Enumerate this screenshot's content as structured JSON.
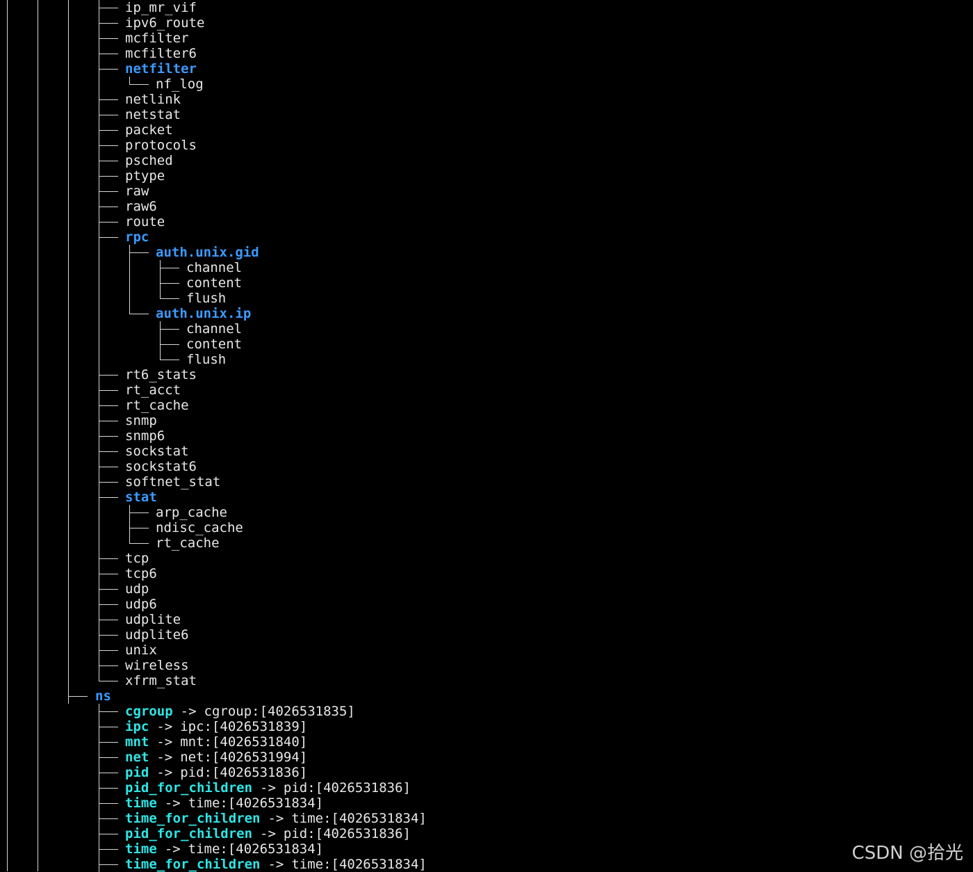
{
  "colors": {
    "background": "#000000",
    "text": "#e8e8e8",
    "directory": "#3a9bff",
    "symlink": "#2ee6e6",
    "tree_lines": "#d8d8d8",
    "watermark": "#d0d0d0"
  },
  "tree": [
    {
      "depth": 1,
      "name": "ip_mr_vif",
      "kind": "file"
    },
    {
      "depth": 1,
      "name": "ipv6_route",
      "kind": "file"
    },
    {
      "depth": 1,
      "name": "mcfilter",
      "kind": "file"
    },
    {
      "depth": 1,
      "name": "mcfilter6",
      "kind": "file"
    },
    {
      "depth": 1,
      "name": "netfilter",
      "kind": "dir"
    },
    {
      "depth": 2,
      "name": "nf_log",
      "kind": "file",
      "last": true
    },
    {
      "depth": 1,
      "name": "netlink",
      "kind": "file"
    },
    {
      "depth": 1,
      "name": "netstat",
      "kind": "file"
    },
    {
      "depth": 1,
      "name": "packet",
      "kind": "file"
    },
    {
      "depth": 1,
      "name": "protocols",
      "kind": "file"
    },
    {
      "depth": 1,
      "name": "psched",
      "kind": "file"
    },
    {
      "depth": 1,
      "name": "ptype",
      "kind": "file"
    },
    {
      "depth": 1,
      "name": "raw",
      "kind": "file"
    },
    {
      "depth": 1,
      "name": "raw6",
      "kind": "file"
    },
    {
      "depth": 1,
      "name": "route",
      "kind": "file"
    },
    {
      "depth": 1,
      "name": "rpc",
      "kind": "dir"
    },
    {
      "depth": 2,
      "name": "auth.unix.gid",
      "kind": "dir"
    },
    {
      "depth": 3,
      "name": "channel",
      "kind": "file"
    },
    {
      "depth": 3,
      "name": "content",
      "kind": "file"
    },
    {
      "depth": 3,
      "name": "flush",
      "kind": "file",
      "last": true
    },
    {
      "depth": 2,
      "name": "auth.unix.ip",
      "kind": "dir",
      "last": true
    },
    {
      "depth": 3,
      "name": "channel",
      "kind": "file"
    },
    {
      "depth": 3,
      "name": "content",
      "kind": "file"
    },
    {
      "depth": 3,
      "name": "flush",
      "kind": "file",
      "last": true
    },
    {
      "depth": 1,
      "name": "rt6_stats",
      "kind": "file"
    },
    {
      "depth": 1,
      "name": "rt_acct",
      "kind": "file"
    },
    {
      "depth": 1,
      "name": "rt_cache",
      "kind": "file"
    },
    {
      "depth": 1,
      "name": "snmp",
      "kind": "file"
    },
    {
      "depth": 1,
      "name": "snmp6",
      "kind": "file"
    },
    {
      "depth": 1,
      "name": "sockstat",
      "kind": "file"
    },
    {
      "depth": 1,
      "name": "sockstat6",
      "kind": "file"
    },
    {
      "depth": 1,
      "name": "softnet_stat",
      "kind": "file"
    },
    {
      "depth": 1,
      "name": "stat",
      "kind": "dir"
    },
    {
      "depth": 2,
      "name": "arp_cache",
      "kind": "file"
    },
    {
      "depth": 2,
      "name": "ndisc_cache",
      "kind": "file"
    },
    {
      "depth": 2,
      "name": "rt_cache",
      "kind": "file",
      "last": true
    },
    {
      "depth": 1,
      "name": "tcp",
      "kind": "file"
    },
    {
      "depth": 1,
      "name": "tcp6",
      "kind": "file"
    },
    {
      "depth": 1,
      "name": "udp",
      "kind": "file"
    },
    {
      "depth": 1,
      "name": "udp6",
      "kind": "file"
    },
    {
      "depth": 1,
      "name": "udplite",
      "kind": "file"
    },
    {
      "depth": 1,
      "name": "udplite6",
      "kind": "file"
    },
    {
      "depth": 1,
      "name": "unix",
      "kind": "file"
    },
    {
      "depth": 1,
      "name": "wireless",
      "kind": "file"
    },
    {
      "depth": 1,
      "name": "xfrm_stat",
      "kind": "file",
      "last": true
    },
    {
      "depth": 0,
      "name": "ns",
      "kind": "dir"
    },
    {
      "depth": 1,
      "name": "cgroup",
      "kind": "link",
      "arrow": "->",
      "target": "cgroup:[4026531835]"
    },
    {
      "depth": 1,
      "name": "ipc",
      "kind": "link",
      "arrow": "->",
      "target": "ipc:[4026531839]"
    },
    {
      "depth": 1,
      "name": "mnt",
      "kind": "link",
      "arrow": "->",
      "target": "mnt:[4026531840]"
    },
    {
      "depth": 1,
      "name": "net",
      "kind": "link",
      "arrow": "->",
      "target": "net:[4026531994]"
    },
    {
      "depth": 1,
      "name": "pid",
      "kind": "link",
      "arrow": "->",
      "target": "pid:[4026531836]"
    },
    {
      "depth": 1,
      "name": "pid_for_children",
      "kind": "link",
      "arrow": "->",
      "target": "pid:[4026531836]"
    },
    {
      "depth": 1,
      "name": "time",
      "kind": "link",
      "arrow": "->",
      "target": "time:[4026531834]"
    },
    {
      "depth": 1,
      "name": "time_for_children",
      "kind": "link",
      "arrow": "->",
      "target": "time:[4026531834]"
    },
    {
      "depth": 1,
      "name": "pid_for_children",
      "kind": "link",
      "arrow": "->",
      "target": "pid:[4026531836]"
    },
    {
      "depth": 1,
      "name": "time",
      "kind": "link",
      "arrow": "->",
      "target": "time:[4026531834]"
    },
    {
      "depth": 1,
      "name": "time_for_children",
      "kind": "link",
      "arrow": "->",
      "target": "time:[4026531834]"
    }
  ],
  "watermark": "CSDN @拾光"
}
